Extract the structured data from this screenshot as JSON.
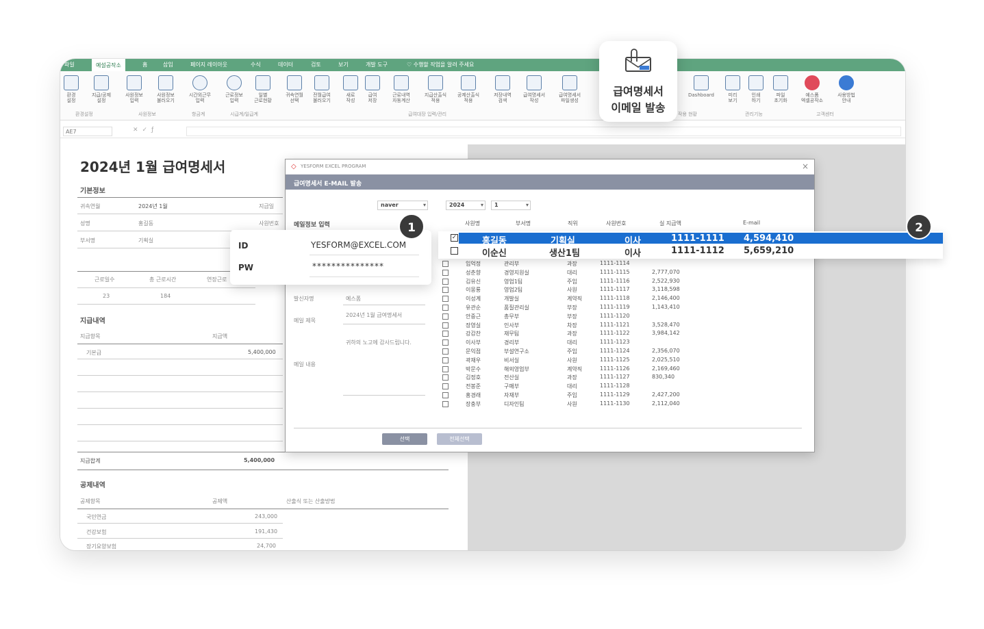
{
  "tabs": [
    "파일",
    "예설공작소",
    "홈",
    "삽입",
    "페이지 레이아웃",
    "수식",
    "데이터",
    "검토",
    "보기",
    "개발 도구",
    "♡ 수행할 작업을 알려 주세요"
  ],
  "ribbon_buttons": [
    "환경\n설정",
    "지급/공제\n설정",
    "사원정보\n입력",
    "사원정보\n불러오기",
    "시간외근무\n입력",
    "근로정보\n입력",
    "일별\n근로현황",
    "귀속연월\n선택",
    "전월급여\n불러오기",
    "새로\n작성",
    "급여\n저장",
    "근로내역\n자동계산",
    "지급산출식\n적용",
    "공제산출식\n적용",
    "저장내역\n검색",
    "급여명세서\n작성",
    "급여명세서\n파일생성",
    "Dashboard",
    "미리\n보기",
    "인쇄\n하기",
    "파일\n초기화",
    "예스폼\n엑셀공작소",
    "사용방법\n안내"
  ],
  "ribbon_groups": [
    "환경설정",
    "사원정보",
    "항금계",
    "시급계/일급계",
    "급여대장 입력/관리",
    "작용 현황",
    "관리기능",
    "고객센터"
  ],
  "namebox": "AE7",
  "callout": {
    "line1": "급여명세서",
    "line2": "이메일 발송"
  },
  "sheet": {
    "title": "2024년 1월 급여명세서",
    "basic_label": "기본정보",
    "rows": [
      [
        "귀속연월",
        "2024년 1월",
        "지급일"
      ],
      [
        "성명",
        "홍길동",
        "사원번호"
      ],
      [
        "부서명",
        "기획실",
        ""
      ]
    ],
    "work_headers": [
      "근로일수",
      "총 근로시간",
      "연장근로"
    ],
    "work_values": [
      "23",
      "184"
    ],
    "pay_section": "지급내역",
    "pay_headers": [
      "지급항목",
      "지급액"
    ],
    "pay_items": [
      [
        "기본급",
        "5,400,000"
      ]
    ],
    "pay_total_label": "지급합계",
    "pay_total": "5,400,000",
    "deduct_section": "공제내역",
    "deduct_headers": [
      "공제항목",
      "공제액",
      "산출식 또는 산출방법"
    ],
    "deduct_items": [
      [
        "국민연금",
        "243,000"
      ],
      [
        "건강보험",
        "191,430"
      ],
      [
        "장기요양보험",
        "24,700"
      ]
    ]
  },
  "dialog": {
    "app": "YESFORM EXCEL PROGRAM",
    "header": "급여명세서 E-MAIL 발송",
    "mail_service": "naver",
    "year": "2024",
    "month": "1",
    "mail_input_label": "메일정보 입력",
    "sender_label": "발신자명",
    "sender_value": "예스폼",
    "subject_label": "메일 제목",
    "subject_value": "2024년 1월 급여명세서",
    "body_label": "메일 내용",
    "body_value": "귀하의 노고에 감사드립니다.",
    "columns": [
      "사원명",
      "부서명",
      "직위",
      "사원번호",
      "실 지급액",
      "E-mail"
    ],
    "employees": [
      [
        "임억정",
        "관리부",
        "과장",
        "1111-1114",
        ""
      ],
      [
        "성춘향",
        "경영지원실",
        "대리",
        "1111-1115",
        "2,777,070"
      ],
      [
        "김유신",
        "영업1팀",
        "주임",
        "1111-1116",
        "2,522,930"
      ],
      [
        "이몽룡",
        "영업2팀",
        "사원",
        "1111-1117",
        "3,118,598"
      ],
      [
        "이성계",
        "개발실",
        "계약직",
        "1111-1118",
        "2,146,400"
      ],
      [
        "유관순",
        "품질관리실",
        "부장",
        "1111-1119",
        "1,143,410"
      ],
      [
        "안중근",
        "총무부",
        "부장",
        "1111-1120",
        ""
      ],
      [
        "장영실",
        "인사부",
        "차장",
        "1111-1121",
        "3,528,470"
      ],
      [
        "강감찬",
        "재무팀",
        "과장",
        "1111-1122",
        "3,984,142"
      ],
      [
        "이사부",
        "경리부",
        "대리",
        "1111-1123",
        ""
      ],
      [
        "문익점",
        "부설연구소",
        "주임",
        "1111-1124",
        "2,356,070"
      ],
      [
        "곽재우",
        "비서실",
        "사원",
        "1111-1125",
        "2,025,510"
      ],
      [
        "박문수",
        "해외영업부",
        "계약직",
        "1111-1126",
        "2,169,460"
      ],
      [
        "김정호",
        "전산실",
        "과장",
        "1111-1127",
        "830,340"
      ],
      [
        "전봉준",
        "구매부",
        "대리",
        "1111-1128",
        ""
      ],
      [
        "홍경래",
        "자재부",
        "주임",
        "1111-1129",
        "2,427,200"
      ],
      [
        "장충부",
        "디자인팀",
        "사원",
        "1111-1130",
        "2,112,040"
      ]
    ],
    "select_btn": "선택",
    "select_all_btn": "전체선택"
  },
  "login": {
    "id_label": "ID",
    "id_value": "YESFORM@EXCEL.COM",
    "pw_label": "PW",
    "pw_value": "***************"
  },
  "highlight_rows": [
    {
      "name": "홍길동",
      "dept": "기획실",
      "title": "이사",
      "no": "1111-1111",
      "amount": "4,594,410",
      "checked": true
    },
    {
      "name": "이순신",
      "dept": "생산1팀",
      "title": "이사",
      "no": "1111-1112",
      "amount": "5,659,210",
      "checked": false
    }
  ],
  "badges": [
    "1",
    "2"
  ],
  "colors": {
    "excel_green": "#5fa47f",
    "highlight_blue": "#1a6ed0",
    "dialog_header": "#8a91a3"
  }
}
